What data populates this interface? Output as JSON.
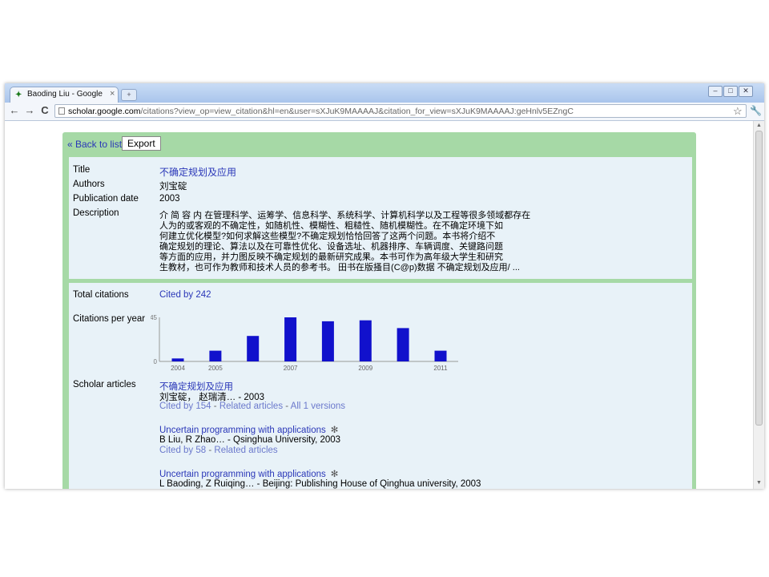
{
  "browser": {
    "tab_title": "Baoding Liu - Google Schol",
    "tab_close": "×",
    "new_tab": "+",
    "url_host": "scholar.google.com",
    "url_path": "/citations?view_op=view_citation&hl=en&user=sXJuK9MAAAAJ&citation_for_view=sXJuK9MAAAAJ:geHnlv5EZngC",
    "back": "←",
    "forward": "→",
    "reload": "C",
    "star": "☆",
    "wrench": "🔧",
    "minimize": "–",
    "maximize": "□",
    "close": "✕"
  },
  "nav": {
    "back_label": "« Back to list",
    "export_label": "Export"
  },
  "details": {
    "title_label": "Title",
    "title_value": "不确定规划及应用",
    "authors_label": "Authors",
    "authors_value": "刘宝碇",
    "date_label": "Publication date",
    "date_value": "2003",
    "description_label": "Description",
    "description_lines": [
      "介 简 容 内 在管理科学、运筹学、信息科学、系统科学、计算机科学以及工程等很多领域都存在",
      "人为的或客观的不确定性，如随机性、模糊性、粗糙性、随机模糊性。在不确定环境下如",
      "何建立优化模型?如何求解这些模型?不确定规划恰恰回答了这两个问题。本书将介绍不",
      "确定规划的理论、算法以及在可靠性优化、设备选址、机器排序、车辆调度、关键路问题",
      "等方面的应用，并力图反映不确定规划的最新研究成果。本书可作为高年级大学生和研究",
      "生教材，也可作为教师和技术人员的参考书。 田书在版搔目(C@p)数据 不确定规划及应用/ ..."
    ]
  },
  "citations": {
    "total_label": "Total citations",
    "total_value": "Cited by 242",
    "per_year_label": "Citations per year",
    "scholar_label": "Scholar articles"
  },
  "chart_data": {
    "type": "bar",
    "x": [
      2004,
      2005,
      2006,
      2007,
      2008,
      2009,
      2010,
      2011
    ],
    "values": [
      3,
      11,
      26,
      45,
      41,
      42,
      34,
      11
    ],
    "ylim": [
      0,
      45
    ],
    "yticks": [
      "45",
      "0"
    ],
    "xticklabels": [
      "2004",
      "2005",
      "2007",
      "2009",
      "2011"
    ],
    "bar_color": "#1111cc",
    "grid": false
  },
  "articles": [
    {
      "title": "不确定规划及应用",
      "star": "",
      "meta": "刘宝碇， 赵瑞清… - 2003",
      "links": [
        "Cited by 154",
        "Related articles",
        "All 1 versions"
      ]
    },
    {
      "title": "Uncertain programming with applications",
      "star": "✻",
      "meta": "B Liu, R Zhao… - Qsinghua University, 2003",
      "links": [
        "Cited by 58",
        "Related articles"
      ]
    },
    {
      "title": "Uncertain programming with applications",
      "star": "✻",
      "meta": "L Baoding, Z Ruiqing… - Beijing: Publishing House of Qinghua university, 2003",
      "links": []
    }
  ],
  "colors": {
    "header_green": "#a6d9a6",
    "panel_blue": "#e8f2f8",
    "link_blue": "#2a37b8"
  }
}
